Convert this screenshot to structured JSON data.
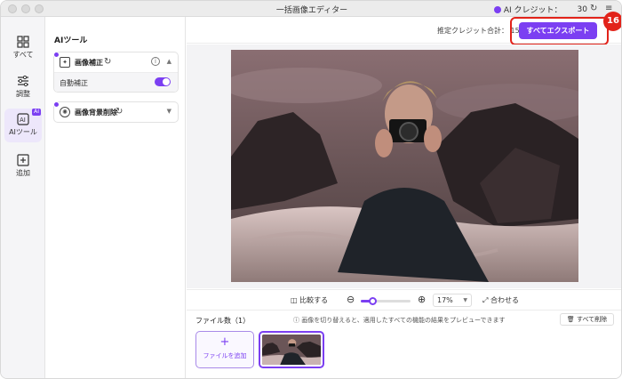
{
  "window": {
    "title": "一括画像エディター",
    "credits_label": "AI クレジット：",
    "credits_value": "30"
  },
  "rail": {
    "items": [
      {
        "label": "すべて",
        "icon": "grid-icon"
      },
      {
        "label": "調整",
        "icon": "sliders-icon"
      },
      {
        "label": "AIツール",
        "icon": "ai-tool-icon",
        "badge": "AI",
        "active": true
      },
      {
        "label": "追加",
        "icon": "plus-square-icon"
      }
    ]
  },
  "panel": {
    "title": "AIツール",
    "tools": [
      {
        "label": "画像補正",
        "expanded": true,
        "sub_label": "自動補正",
        "toggle_on": true
      },
      {
        "label": "画像背景削除",
        "expanded": false
      }
    ]
  },
  "topbar": {
    "estimate_label": "推定クレジット合計：",
    "estimate_value": "15",
    "export_label": "すべてエクスポート",
    "step_badge": "16"
  },
  "controls": {
    "compare_label": "比較する",
    "zoom_value": "17%",
    "zoom_fraction": 0.17,
    "fit_label": "合わせる"
  },
  "files": {
    "count_label": "ファイル数（1）",
    "hint": "画像を切り替えると、適用したすべての機能の結果をプレビューできます",
    "delete_all_label": "すべて削除",
    "add_label": "ファイルを追加"
  },
  "colors": {
    "accent": "#7b3ff2",
    "highlight": "#e2231a"
  }
}
